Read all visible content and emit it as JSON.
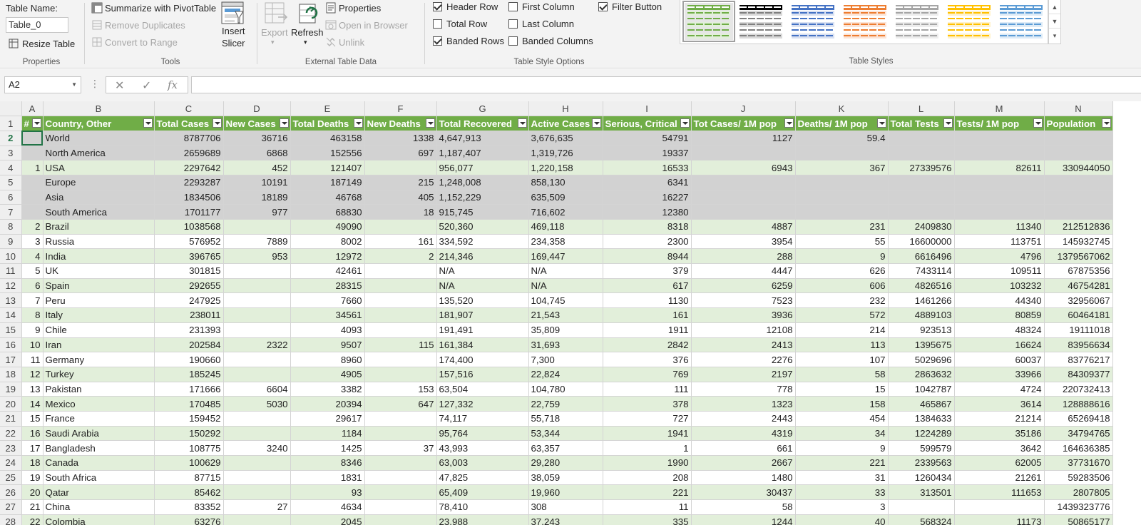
{
  "ribbon": {
    "properties": {
      "table_name_label": "Table Name:",
      "table_name_value": "Table_0",
      "resize_table": "Resize Table",
      "group_label": "Properties"
    },
    "tools": {
      "summarize_pivot": "Summarize with PivotTable",
      "remove_duplicates": "Remove Duplicates",
      "convert_to_range": "Convert to Range",
      "insert_slicer_line1": "Insert",
      "insert_slicer_line2": "Slicer",
      "group_label": "Tools"
    },
    "external": {
      "export": "Export",
      "refresh": "Refresh",
      "properties": "Properties",
      "open_in_browser": "Open in Browser",
      "unlink": "Unlink",
      "group_label": "External Table Data"
    },
    "style_options": {
      "header_row": "Header Row",
      "total_row": "Total Row",
      "banded_rows": "Banded Rows",
      "first_column": "First Column",
      "last_column": "Last Column",
      "banded_columns": "Banded Columns",
      "filter_button": "Filter Button",
      "header_row_checked": true,
      "total_row_checked": false,
      "banded_rows_checked": true,
      "first_column_checked": false,
      "last_column_checked": false,
      "banded_columns_checked": false,
      "filter_button_checked": true,
      "group_label": "Table Style Options"
    },
    "table_styles": {
      "group_label": "Table Styles",
      "swatches": [
        {
          "name": "green-light",
          "header": "#70ad47",
          "band": "#e2efda",
          "line": "#70ad47"
        },
        {
          "name": "black-medium",
          "header": "#000000",
          "band": "#d9d9d9",
          "line": "#7f7f7f"
        },
        {
          "name": "blue-medium",
          "header": "#4472c4",
          "band": "#d9e1f2",
          "line": "#4472c4"
        },
        {
          "name": "orange-medium",
          "header": "#ed7d31",
          "band": "#fce4d6",
          "line": "#ed7d31"
        },
        {
          "name": "gray-medium",
          "header": "#a5a5a5",
          "band": "#ededed",
          "line": "#a5a5a5"
        },
        {
          "name": "gold-medium",
          "header": "#ffc000",
          "band": "#fff2cc",
          "line": "#ffc000"
        },
        {
          "name": "blue2-medium",
          "header": "#5b9bd5",
          "band": "#ddebf7",
          "line": "#5b9bd5"
        }
      ]
    }
  },
  "formula_bar": {
    "name_box": "A2",
    "formula": ""
  },
  "colors": {
    "header_green": "#70ad47",
    "band_green": "#e2efda",
    "aggregate_gray": "#d2d2d2",
    "selection_green": "#217346"
  },
  "grid": {
    "column_letters": [
      "A",
      "B",
      "C",
      "D",
      "E",
      "F",
      "G",
      "H",
      "I",
      "J",
      "K",
      "L",
      "M",
      "N"
    ],
    "headers": [
      "#",
      "Country, Other",
      "Total Cases",
      "New Cases",
      "Total Deaths",
      "New Deaths",
      "Total Recovered",
      "Active Cases",
      "Serious, Critical",
      "Tot Cases/ 1M pop",
      "Deaths/ 1M pop",
      "Total Tests",
      "Tests/ 1M pop",
      "Population"
    ],
    "rows": [
      {
        "n": "2",
        "style": "agg",
        "cells": [
          "",
          "World",
          "8787706",
          "36716",
          "463158",
          "1338",
          "4,647,913",
          "3,676,635",
          "54791",
          "1127",
          "59.4",
          "",
          "",
          ""
        ]
      },
      {
        "n": "3",
        "style": "agg",
        "cells": [
          "",
          "North America",
          "2659689",
          "6868",
          "152556",
          "697",
          "1,187,407",
          "1,319,726",
          "19337",
          "",
          "",
          "",
          "",
          ""
        ]
      },
      {
        "n": "4",
        "style": "band",
        "cells": [
          "1",
          "USA",
          "2297642",
          "452",
          "121407",
          "",
          "956,077",
          "1,220,158",
          "16533",
          "6943",
          "367",
          "27339576",
          "82611",
          "330944050"
        ]
      },
      {
        "n": "5",
        "style": "agg",
        "cells": [
          "",
          "Europe",
          "2293287",
          "10191",
          "187149",
          "215",
          "1,248,008",
          "858,130",
          "6341",
          "",
          "",
          "",
          "",
          ""
        ]
      },
      {
        "n": "6",
        "style": "agg",
        "cells": [
          "",
          "Asia",
          "1834506",
          "18189",
          "46768",
          "405",
          "1,152,229",
          "635,509",
          "16227",
          "",
          "",
          "",
          "",
          ""
        ]
      },
      {
        "n": "7",
        "style": "agg",
        "cells": [
          "",
          "South America",
          "1701177",
          "977",
          "68830",
          "18",
          "915,745",
          "716,602",
          "12380",
          "",
          "",
          "",
          "",
          ""
        ]
      },
      {
        "n": "8",
        "style": "band",
        "cells": [
          "2",
          "Brazil",
          "1038568",
          "",
          "49090",
          "",
          "520,360",
          "469,118",
          "8318",
          "4887",
          "231",
          "2409830",
          "11340",
          "212512836"
        ]
      },
      {
        "n": "9",
        "style": "plain",
        "cells": [
          "3",
          "Russia",
          "576952",
          "7889",
          "8002",
          "161",
          "334,592",
          "234,358",
          "2300",
          "3954",
          "55",
          "16600000",
          "113751",
          "145932745"
        ]
      },
      {
        "n": "10",
        "style": "band",
        "cells": [
          "4",
          "India",
          "396765",
          "953",
          "12972",
          "2",
          "214,346",
          "169,447",
          "8944",
          "288",
          "9",
          "6616496",
          "4796",
          "1379567062"
        ]
      },
      {
        "n": "11",
        "style": "plain",
        "cells": [
          "5",
          "UK",
          "301815",
          "",
          "42461",
          "",
          "N/A",
          "N/A",
          "379",
          "4447",
          "626",
          "7433114",
          "109511",
          "67875356"
        ]
      },
      {
        "n": "12",
        "style": "band",
        "cells": [
          "6",
          "Spain",
          "292655",
          "",
          "28315",
          "",
          "N/A",
          "N/A",
          "617",
          "6259",
          "606",
          "4826516",
          "103232",
          "46754281"
        ]
      },
      {
        "n": "13",
        "style": "plain",
        "cells": [
          "7",
          "Peru",
          "247925",
          "",
          "7660",
          "",
          "135,520",
          "104,745",
          "1130",
          "7523",
          "232",
          "1461266",
          "44340",
          "32956067"
        ]
      },
      {
        "n": "14",
        "style": "band",
        "cells": [
          "8",
          "Italy",
          "238011",
          "",
          "34561",
          "",
          "181,907",
          "21,543",
          "161",
          "3936",
          "572",
          "4889103",
          "80859",
          "60464181"
        ]
      },
      {
        "n": "15",
        "style": "plain",
        "cells": [
          "9",
          "Chile",
          "231393",
          "",
          "4093",
          "",
          "191,491",
          "35,809",
          "1911",
          "12108",
          "214",
          "923513",
          "48324",
          "19111018"
        ]
      },
      {
        "n": "16",
        "style": "band",
        "cells": [
          "10",
          "Iran",
          "202584",
          "2322",
          "9507",
          "115",
          "161,384",
          "31,693",
          "2842",
          "2413",
          "113",
          "1395675",
          "16624",
          "83956634"
        ]
      },
      {
        "n": "17",
        "style": "plain",
        "cells": [
          "11",
          "Germany",
          "190660",
          "",
          "8960",
          "",
          "174,400",
          "7,300",
          "376",
          "2276",
          "107",
          "5029696",
          "60037",
          "83776217"
        ]
      },
      {
        "n": "18",
        "style": "band",
        "cells": [
          "12",
          "Turkey",
          "185245",
          "",
          "4905",
          "",
          "157,516",
          "22,824",
          "769",
          "2197",
          "58",
          "2863632",
          "33966",
          "84309377"
        ]
      },
      {
        "n": "19",
        "style": "plain",
        "cells": [
          "13",
          "Pakistan",
          "171666",
          "6604",
          "3382",
          "153",
          "63,504",
          "104,780",
          "111",
          "778",
          "15",
          "1042787",
          "4724",
          "220732413"
        ]
      },
      {
        "n": "20",
        "style": "band",
        "cells": [
          "14",
          "Mexico",
          "170485",
          "5030",
          "20394",
          "647",
          "127,332",
          "22,759",
          "378",
          "1323",
          "158",
          "465867",
          "3614",
          "128888616"
        ]
      },
      {
        "n": "21",
        "style": "plain",
        "cells": [
          "15",
          "France",
          "159452",
          "",
          "29617",
          "",
          "74,117",
          "55,718",
          "727",
          "2443",
          "454",
          "1384633",
          "21214",
          "65269418"
        ]
      },
      {
        "n": "22",
        "style": "band",
        "cells": [
          "16",
          "Saudi Arabia",
          "150292",
          "",
          "1184",
          "",
          "95,764",
          "53,344",
          "1941",
          "4319",
          "34",
          "1224289",
          "35186",
          "34794765"
        ]
      },
      {
        "n": "23",
        "style": "plain",
        "cells": [
          "17",
          "Bangladesh",
          "108775",
          "3240",
          "1425",
          "37",
          "43,993",
          "63,357",
          "1",
          "661",
          "9",
          "599579",
          "3642",
          "164636385"
        ]
      },
      {
        "n": "24",
        "style": "band",
        "cells": [
          "18",
          "Canada",
          "100629",
          "",
          "8346",
          "",
          "63,003",
          "29,280",
          "1990",
          "2667",
          "221",
          "2339563",
          "62005",
          "37731670"
        ]
      },
      {
        "n": "25",
        "style": "plain",
        "cells": [
          "19",
          "South Africa",
          "87715",
          "",
          "1831",
          "",
          "47,825",
          "38,059",
          "208",
          "1480",
          "31",
          "1260434",
          "21261",
          "59283506"
        ]
      },
      {
        "n": "26",
        "style": "band",
        "cells": [
          "20",
          "Qatar",
          "85462",
          "",
          "93",
          "",
          "65,409",
          "19,960",
          "221",
          "30437",
          "33",
          "313501",
          "111653",
          "2807805"
        ]
      },
      {
        "n": "27",
        "style": "plain",
        "cells": [
          "21",
          "China",
          "83352",
          "27",
          "4634",
          "",
          "78,410",
          "308",
          "11",
          "58",
          "3",
          "",
          "",
          "1439323776"
        ]
      },
      {
        "n": "28",
        "style": "band",
        "cells": [
          "22",
          "Colombia",
          "63276",
          "",
          "2045",
          "",
          "23,988",
          "37,243",
          "335",
          "1244",
          "40",
          "568324",
          "11173",
          "50865177"
        ]
      }
    ]
  }
}
